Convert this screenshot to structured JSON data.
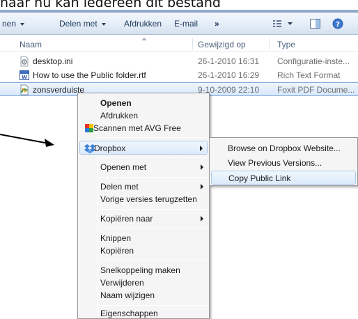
{
  "caption": "naar nu kan iedereen dit bestand",
  "toolbar": {
    "items": [
      "nen",
      "Delen met",
      "Afdrukken",
      "E-mail",
      "»"
    ]
  },
  "columns": [
    "Naam",
    "Gewijzigd op",
    "Type"
  ],
  "files": [
    {
      "name": "desktop.ini",
      "modified": "26-1-2010 16:31",
      "type": "Configuratie-inste..."
    },
    {
      "name": "How to use the Public folder.rtf",
      "modified": "26-1-2010 16:29",
      "type": "Rich Text Format"
    },
    {
      "name": "zonsverduiste",
      "modified": "9-10-2009 22:10",
      "type": "Foxit PDF Docume..."
    }
  ],
  "context_menu": {
    "open": "Openen",
    "print": "Afdrukken",
    "scan": "Scannen met AVG Free",
    "dropbox": "Dropbox",
    "open_with": "Openen met",
    "share_with": "Delen met",
    "previous_versions": "Vorige versies terugzetten",
    "copy_to": "Kopiëren naar",
    "cut": "Knippen",
    "copy": "Kopiëren",
    "create_shortcut": "Snelkoppeling maken",
    "delete": "Verwijderen",
    "rename": "Naam wijzigen",
    "properties": "Eigenschappen"
  },
  "dropbox_submenu": {
    "browse": "Browse on Dropbox Website...",
    "versions": "View Previous Versions...",
    "copy_link": "Copy Public Link"
  },
  "colors": {
    "selection": "#d8e8fb",
    "menu_background": "#f5f5f5",
    "dropbox_blue": "#3d7fd6"
  }
}
